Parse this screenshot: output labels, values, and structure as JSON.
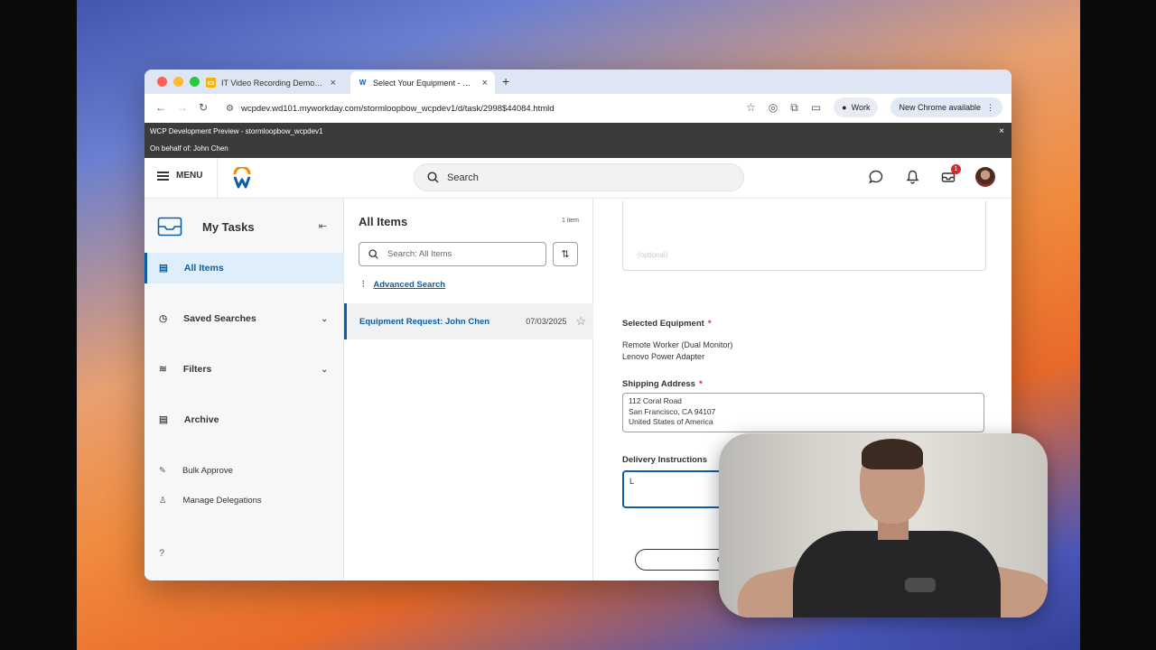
{
  "browser": {
    "tabs": [
      {
        "title": "IT Video Recording Demo - G",
        "favicon": "docs-icon",
        "active": false
      },
      {
        "title": "Select Your Equipment - Wor",
        "favicon": "workday-icon",
        "active": true
      }
    ],
    "url": "wcpdev.wd101.myworkday.com/stormloopbow_wcpdev1/d/task/2998$44084.htmld",
    "profile_label": "Work",
    "update_label": "New Chrome available"
  },
  "banner": {
    "line1": "WCP Development Preview - stormloopbow_wcpdev1",
    "line2": "On behalf of: John Chen"
  },
  "header": {
    "menu_label": "MENU",
    "search_placeholder": "Search",
    "inbox_badge": "1"
  },
  "left_nav": {
    "title": "My Tasks",
    "items": [
      {
        "label": "All Items"
      },
      {
        "label": "Saved Searches"
      },
      {
        "label": "Filters"
      },
      {
        "label": "Archive"
      },
      {
        "label": "Bulk Approve"
      },
      {
        "label": "Manage Delegations"
      }
    ]
  },
  "list_panel": {
    "title": "All Items",
    "count": "1 item",
    "search_placeholder": "Search: All Items",
    "advanced_search": "Advanced Search",
    "rows": [
      {
        "name": "Equipment Request: John Chen",
        "date": "07/03/2025"
      }
    ]
  },
  "form": {
    "optional_placeholder": "(optional)",
    "selected_equipment_label": "Selected Equipment",
    "selected_equipment": [
      "Remote Worker (Dual Monitor)",
      "Lenovo Power Adapter"
    ],
    "shipping_address_label": "Shipping Address",
    "shipping_address": [
      "112 Coral Road",
      "San Francisco, CA 94107",
      "United States of America"
    ],
    "delivery_instructions_label": "Delivery Instructions",
    "delivery_instructions_value": "L",
    "cancel_label": "Ca"
  },
  "colors": {
    "accent": "#0b5ea8",
    "required": "#d8282c",
    "banner_bg": "#3b3b3b"
  }
}
